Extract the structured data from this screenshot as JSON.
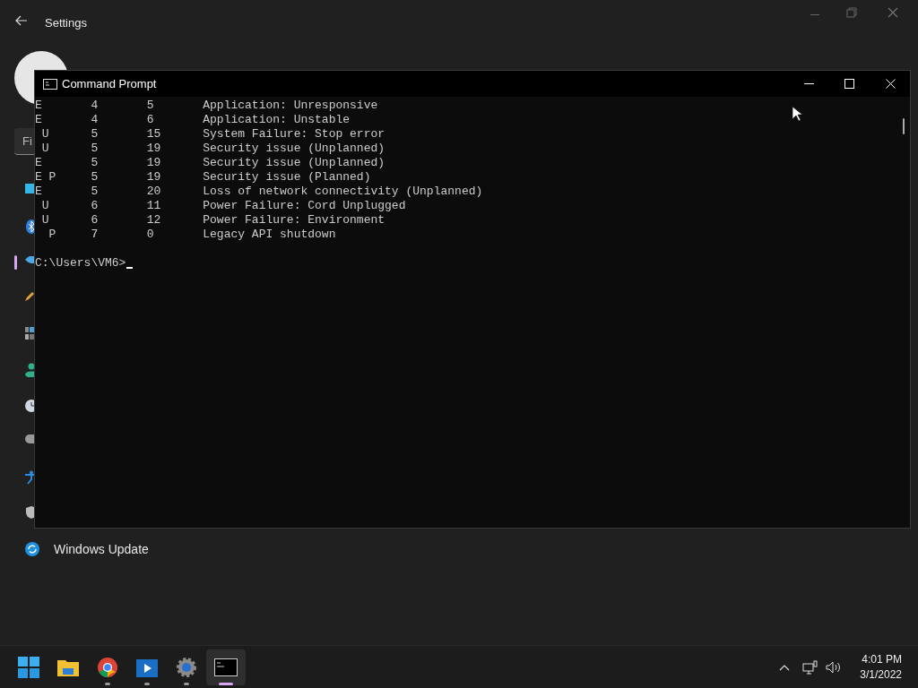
{
  "settings_window": {
    "title": "Settings",
    "search": {
      "placeholder": "Fi"
    },
    "nav_items": [
      {
        "kind": "display",
        "selected": false
      },
      {
        "kind": "bluetooth",
        "selected": false
      },
      {
        "kind": "network",
        "selected": true
      },
      {
        "kind": "brush",
        "selected": false
      },
      {
        "kind": "apps",
        "selected": false
      },
      {
        "kind": "accounts",
        "selected": false
      },
      {
        "kind": "time",
        "selected": false
      },
      {
        "kind": "gaming",
        "selected": false
      },
      {
        "kind": "accessibility",
        "selected": false
      },
      {
        "kind": "privacy",
        "selected": false
      },
      {
        "kind": "update",
        "label": "Windows Update",
        "selected": false
      }
    ]
  },
  "console_window": {
    "title": "Command Prompt",
    "lines": [
      "E       4       5       Application: Unresponsive",
      "E       4       6       Application: Unstable",
      " U      5       15      System Failure: Stop error",
      " U      5       19      Security issue (Unplanned)",
      "E       5       19      Security issue (Unplanned)",
      "E P     5       19      Security issue (Planned)",
      "E       5       20      Loss of network connectivity (Unplanned)",
      " U      6       11      Power Failure: Cord Unplugged",
      " U      6       12      Power Failure: Environment",
      "  P     7       0       Legacy API shutdown",
      "C:\\Users\\VM6>"
    ]
  },
  "taskbar": {
    "apps": [
      {
        "kind": "start",
        "running": false,
        "active": false
      },
      {
        "kind": "explorer",
        "running": false,
        "active": false
      },
      {
        "kind": "chrome",
        "running": true,
        "active": false
      },
      {
        "kind": "video",
        "running": true,
        "active": false
      },
      {
        "kind": "settings",
        "running": true,
        "active": false
      },
      {
        "kind": "terminal",
        "running": true,
        "active": true
      }
    ],
    "time": "4:01 PM",
    "date": "3/1/2022"
  }
}
